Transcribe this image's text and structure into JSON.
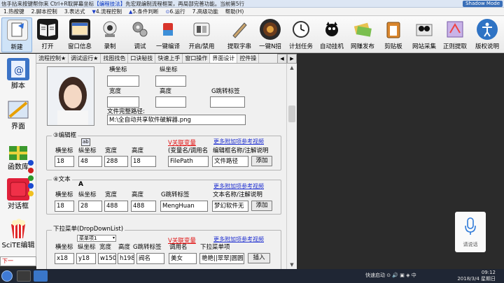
{
  "window": {
    "title_prefix": "信手拈来按键帮你来 Ctrl+R取屏幕坐标",
    "title_highlight": "【编程技法】",
    "title_suffix": "先宏观编制流程框架，再局部完善功能。当前第5行",
    "shadow_mode": "Shadow Mode"
  },
  "menu": [
    {
      "label": "1.热按键"
    },
    {
      "label": "2.脚本控制"
    },
    {
      "label": "3.表达式"
    },
    {
      "label": "4.流程控制"
    },
    {
      "label": "5.条件判断"
    },
    {
      "label": "6.运行"
    },
    {
      "label": "7.高级功能"
    },
    {
      "label": "帮助(H)"
    }
  ],
  "toolbar": [
    {
      "label": "新建",
      "icon": "new-file-icon"
    },
    {
      "label": "打开",
      "icon": "open-book-icon"
    },
    {
      "label": "窗口信息",
      "icon": "window-info-icon"
    },
    {
      "label": "录制",
      "icon": "camera-icon"
    },
    {
      "label": "调试",
      "icon": "gears-icon"
    },
    {
      "label": "一键编译",
      "icon": "compile-icon"
    },
    {
      "label": "开启/禁用",
      "icon": "toggle-icon"
    },
    {
      "label": "提取字串",
      "icon": "pen-icon"
    },
    {
      "label": "一键N招",
      "icon": "game-icon"
    },
    {
      "label": "计划任务",
      "icon": "clock-icon"
    },
    {
      "label": "自动挂机",
      "icon": "cat-icon"
    },
    {
      "label": "网赚发布",
      "icon": "money-icon"
    },
    {
      "label": "剪贴板",
      "icon": "clipboard-icon"
    },
    {
      "label": "网站采集",
      "icon": "web-collect-icon"
    },
    {
      "label": "正则提取",
      "icon": "regex-icon"
    },
    {
      "label": "版权说明",
      "icon": "accessibility-icon"
    }
  ],
  "left_panel": [
    {
      "label": "脚本",
      "icon": "script-icon"
    },
    {
      "label": "界面",
      "icon": "ui-ruler-icon"
    },
    {
      "label": "函数库",
      "icon": "gift-icon"
    },
    {
      "label": "对话框",
      "icon": "dialog-icon"
    },
    {
      "label": "SciTE编辑",
      "icon": "popcorn-icon"
    }
  ],
  "left_bottom": "下一",
  "tabs": [
    {
      "label": "流程控制★"
    },
    {
      "label": "调试运行★"
    },
    {
      "label": "找图找色"
    },
    {
      "label": "口诀秘技"
    },
    {
      "label": "快速上手"
    },
    {
      "label": "窗口操作"
    },
    {
      "label": "界面设计"
    },
    {
      "label": "控件操"
    }
  ],
  "form": {
    "image_group": {
      "x_label": "横坐标",
      "y_label": "纵坐标",
      "w_label": "宽度",
      "h_label": "高度",
      "jump_label": "G跳转标签",
      "path_label": "文件完整路径:",
      "path_value": "M:\\全自动共享软件破解器.png"
    },
    "edit_group": {
      "title": "③编辑框",
      "icon_text": "ab",
      "link_var": "V关联变量",
      "link_more": "更多附加项参考视频",
      "headers": [
        "横坐标",
        "纵坐标",
        "宽度",
        "高度",
        "(变量名/调用名",
        "编辑框名称/注解说明"
      ],
      "values": [
        "18",
        "48",
        "288",
        "18",
        "FilePath",
        "文件路径"
      ],
      "add_button": "添加"
    },
    "text_group": {
      "title": "④文本",
      "icon_text": "A",
      "link_more": "更多附加项参考视频",
      "headers": [
        "横坐标",
        "纵坐标",
        "宽度",
        "高度",
        "G跳转标签",
        "文本名称/注解说明"
      ],
      "values": [
        "18",
        "28",
        "488",
        "488",
        "MengHuan",
        "梦幻软件无"
      ],
      "add_button": "添加"
    },
    "dropdown_group": {
      "title": "下拉菜单(DropDownList)",
      "select_value": "菜单项1",
      "link_var": "V关联变量",
      "link_more": "更多附加项参考视频",
      "headers": [
        "横坐标",
        "纵坐标",
        "宽度",
        "高度",
        "G跳转标签",
        "调用名",
        "下拉菜单项"
      ],
      "values": [
        "x18",
        "y18",
        "w150",
        "h198",
        "阀名",
        "美女",
        "艳艳||翠翠|圆圆"
      ],
      "insert_button": "插入"
    }
  },
  "voice": {
    "label": "请说话"
  },
  "taskbar": {
    "tray_text": "快速启动",
    "time": "09:12",
    "date": "2018/3/4 星期日"
  }
}
